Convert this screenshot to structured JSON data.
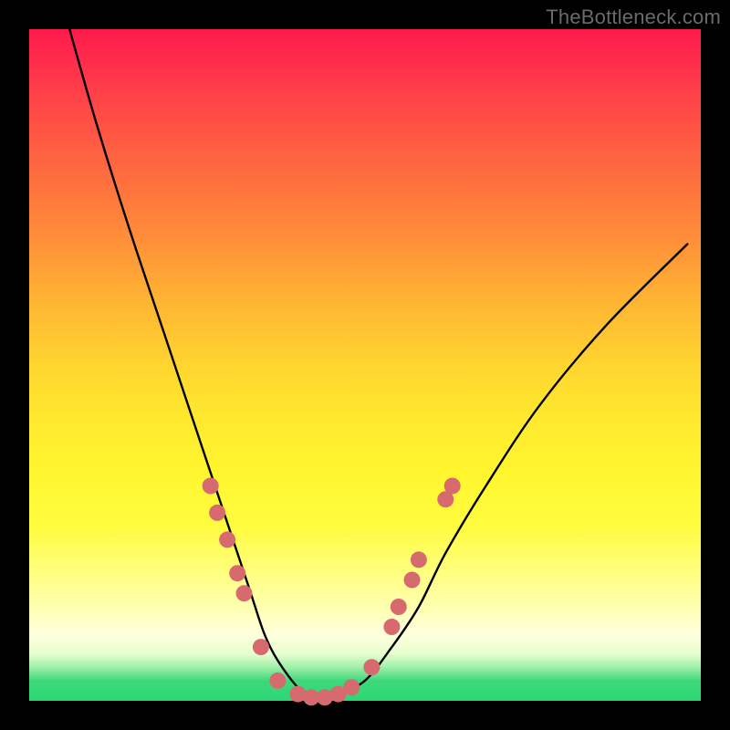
{
  "watermark": "TheBottleneck.com",
  "chart_data": {
    "type": "line",
    "title": "",
    "xlabel": "",
    "ylabel": "",
    "xlim": [
      0,
      100
    ],
    "ylim": [
      0,
      100
    ],
    "series": [
      {
        "name": "bottleneck-curve",
        "x": [
          6,
          10,
          15,
          20,
          24,
          27,
          29,
          31,
          33,
          35,
          37,
          40,
          42,
          44,
          46,
          50,
          54,
          58,
          62,
          68,
          76,
          86,
          98
        ],
        "y": [
          100,
          86,
          70,
          55,
          43,
          34,
          28,
          22,
          16,
          10,
          6,
          2,
          1,
          0,
          1,
          3,
          8,
          14,
          22,
          32,
          44,
          56,
          68
        ]
      }
    ],
    "markers": {
      "name": "data-points",
      "color": "#d76a6f",
      "radius_px": 9,
      "points": [
        {
          "x": 27,
          "y": 32
        },
        {
          "x": 28,
          "y": 28
        },
        {
          "x": 29.5,
          "y": 24
        },
        {
          "x": 31,
          "y": 19
        },
        {
          "x": 32,
          "y": 16
        },
        {
          "x": 34.5,
          "y": 8
        },
        {
          "x": 37,
          "y": 3
        },
        {
          "x": 40,
          "y": 1
        },
        {
          "x": 42,
          "y": 0.5
        },
        {
          "x": 44,
          "y": 0.5
        },
        {
          "x": 46,
          "y": 1
        },
        {
          "x": 48,
          "y": 2
        },
        {
          "x": 51,
          "y": 5
        },
        {
          "x": 54,
          "y": 11
        },
        {
          "x": 55,
          "y": 14
        },
        {
          "x": 57,
          "y": 18
        },
        {
          "x": 58,
          "y": 21
        },
        {
          "x": 62,
          "y": 30
        },
        {
          "x": 63,
          "y": 32
        }
      ]
    },
    "gradient_stops": [
      {
        "pos": 0,
        "color": "#ff1a4c"
      },
      {
        "pos": 50,
        "color": "#ffd52f"
      },
      {
        "pos": 90,
        "color": "#ffffdd"
      },
      {
        "pos": 100,
        "color": "#2bd875"
      }
    ]
  }
}
